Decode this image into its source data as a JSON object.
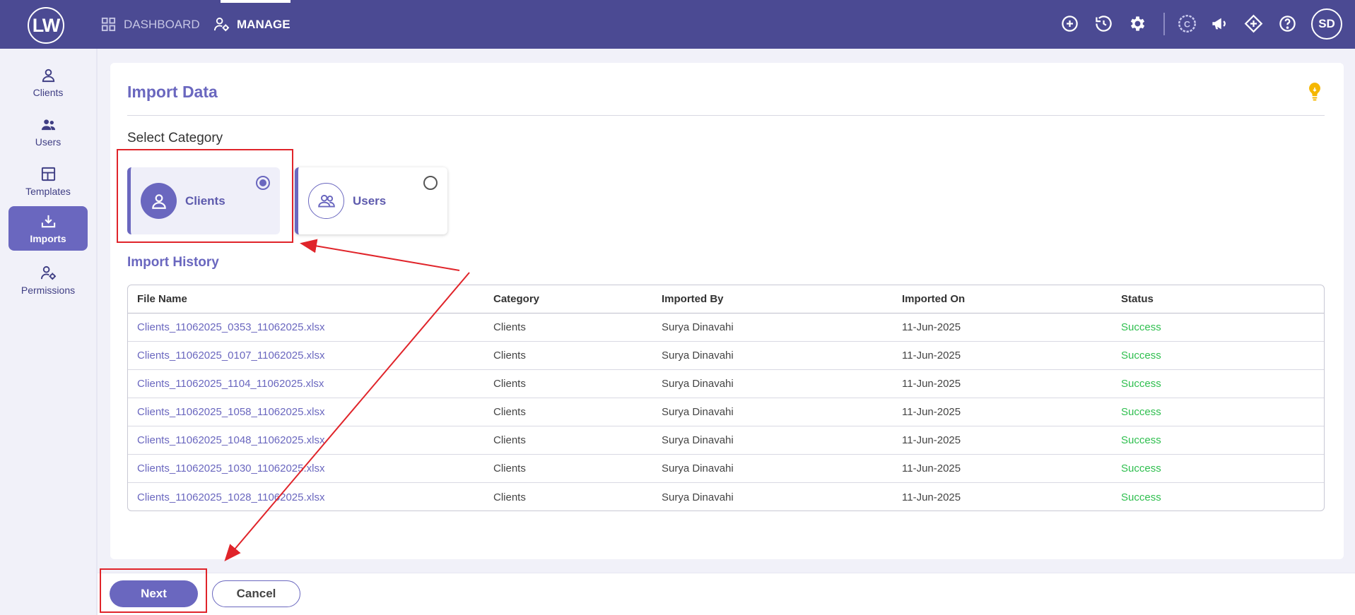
{
  "header": {
    "logo_text": "LW",
    "nav": [
      {
        "label": "DASHBOARD",
        "icon": "grid-icon"
      },
      {
        "label": "MANAGE",
        "icon": "user-gear-icon"
      }
    ],
    "icons": [
      "plus-circle-icon",
      "history-icon",
      "settings-gear-icon",
      "c-logo-icon",
      "megaphone-icon",
      "diamond-icon",
      "help-icon"
    ],
    "avatar_initials": "SD",
    "bg_color": "#4b4a93"
  },
  "sidebar": {
    "items": [
      {
        "label": "Clients",
        "icon": "user-icon"
      },
      {
        "label": "Users",
        "icon": "users-icon"
      },
      {
        "label": "Templates",
        "icon": "template-icon"
      },
      {
        "label": "Imports",
        "icon": "import-icon"
      },
      {
        "label": "Permissions",
        "icon": "user-gear-icon"
      }
    ],
    "active": "Imports"
  },
  "main": {
    "title": "Import Data",
    "select_category_label": "Select Category",
    "categories": [
      {
        "label": "Clients",
        "selected": true
      },
      {
        "label": "Users",
        "selected": false
      }
    ],
    "history_label": "Import History",
    "table": {
      "headers": [
        "File Name",
        "Category",
        "Imported By",
        "Imported On",
        "Status"
      ],
      "rows": [
        [
          "Clients_11062025_0353_11062025.xlsx",
          "Clients",
          "Surya Dinavahi",
          "11-Jun-2025",
          "Success"
        ],
        [
          "Clients_11062025_0107_11062025.xlsx",
          "Clients",
          "Surya Dinavahi",
          "11-Jun-2025",
          "Success"
        ],
        [
          "Clients_11062025_1104_11062025.xlsx",
          "Clients",
          "Surya Dinavahi",
          "11-Jun-2025",
          "Success"
        ],
        [
          "Clients_11062025_1058_11062025.xlsx",
          "Clients",
          "Surya Dinavahi",
          "11-Jun-2025",
          "Success"
        ],
        [
          "Clients_11062025_1048_11062025.xlsx",
          "Clients",
          "Surya Dinavahi",
          "11-Jun-2025",
          "Success"
        ],
        [
          "Clients_11062025_1030_11062025.xlsx",
          "Clients",
          "Surya Dinavahi",
          "11-Jun-2025",
          "Success"
        ],
        [
          "Clients_11062025_1028_11062025.xlsx",
          "Clients",
          "Surya Dinavahi",
          "11-Jun-2025",
          "Success"
        ]
      ]
    }
  },
  "footer": {
    "next_label": "Next",
    "cancel_label": "Cancel"
  },
  "colors": {
    "accent": "#6a67bf",
    "success": "#2fbf4f",
    "annotation": "#e0242a",
    "bulb": "#f5b700"
  }
}
